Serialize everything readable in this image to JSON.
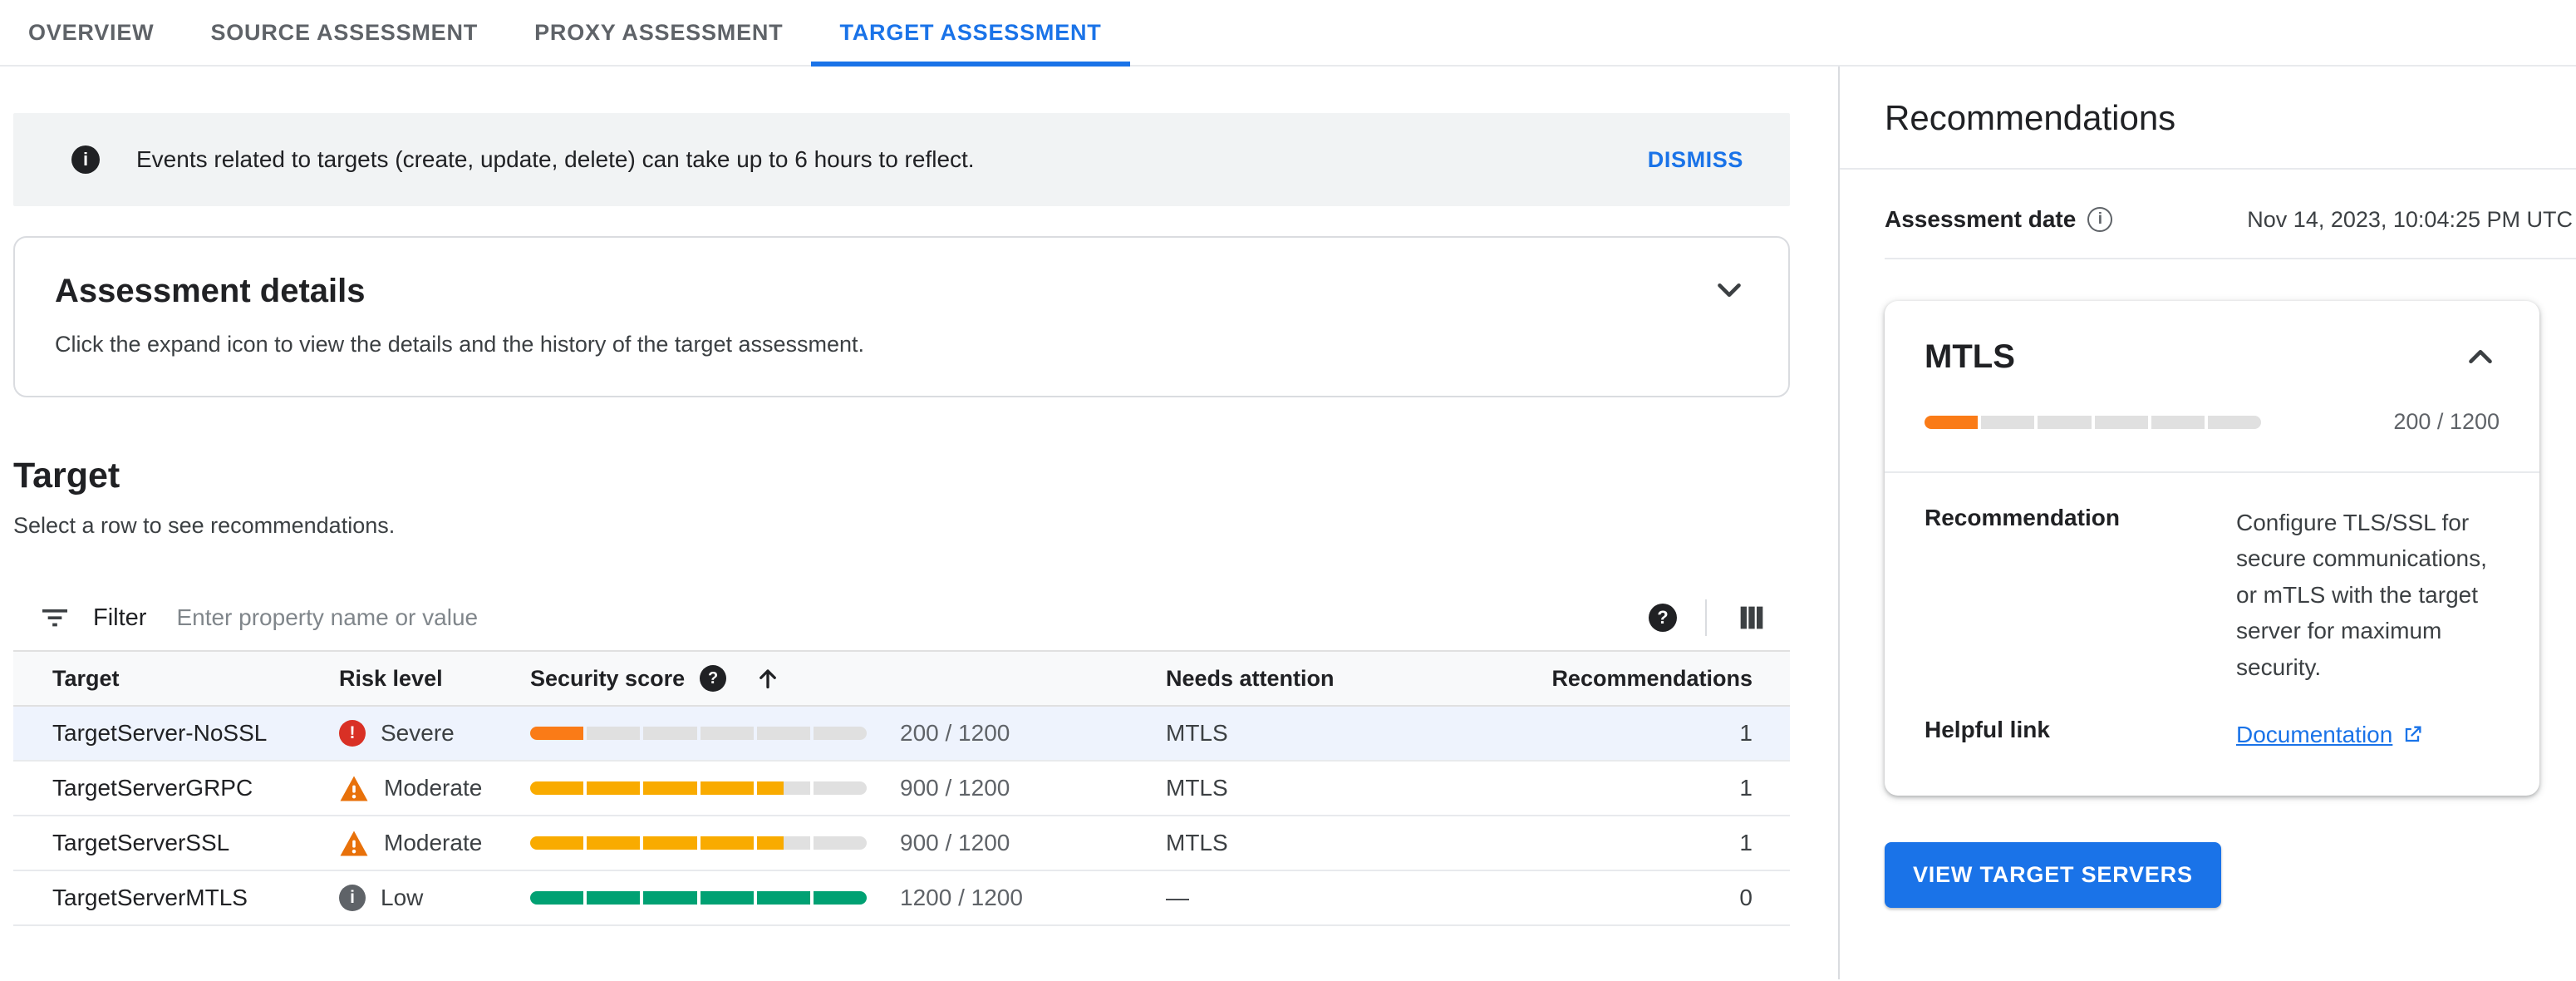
{
  "tabs": [
    {
      "label": "OVERVIEW",
      "active": false
    },
    {
      "label": "SOURCE ASSESSMENT",
      "active": false
    },
    {
      "label": "PROXY ASSESSMENT",
      "active": false
    },
    {
      "label": "TARGET ASSESSMENT",
      "active": true
    }
  ],
  "banner": {
    "text": "Events related to targets (create, update, delete) can take up to 6 hours to reflect.",
    "dismiss_label": "DISMISS"
  },
  "assessment_details": {
    "title": "Assessment details",
    "subtitle": "Click the expand icon to view the details and the history of the target assessment."
  },
  "target_section": {
    "title": "Target",
    "subtitle": "Select a row to see recommendations."
  },
  "filter": {
    "label": "Filter",
    "placeholder": "Enter property name or value"
  },
  "table": {
    "columns": [
      "Target",
      "Risk level",
      "Security score",
      "Needs attention",
      "Recommendations"
    ],
    "rows": [
      {
        "target": "TargetServer-NoSSL",
        "risk": "severe",
        "risk_label": "Severe",
        "score": 200,
        "max": 1200,
        "score_text": "200 / 1200",
        "needs_attention": "MTLS",
        "recommendations": "1",
        "selected": true
      },
      {
        "target": "TargetServerGRPC",
        "risk": "moderate",
        "risk_label": "Moderate",
        "score": 900,
        "max": 1200,
        "score_text": "900 / 1200",
        "needs_attention": "MTLS",
        "recommendations": "1",
        "selected": false
      },
      {
        "target": "TargetServerSSL",
        "risk": "moderate",
        "risk_label": "Moderate",
        "score": 900,
        "max": 1200,
        "score_text": "900 / 1200",
        "needs_attention": "MTLS",
        "recommendations": "1",
        "selected": false
      },
      {
        "target": "TargetServerMTLS",
        "risk": "low",
        "risk_label": "Low",
        "score": 1200,
        "max": 1200,
        "score_text": "1200 / 1200",
        "needs_attention": "—",
        "recommendations": "0",
        "selected": false
      }
    ]
  },
  "panel": {
    "title": "Recommendations",
    "assessment_date_label": "Assessment date",
    "assessment_date_value": "Nov 14, 2023, 10:04:25 PM UTC",
    "card": {
      "title": "MTLS",
      "score": 200,
      "max": 1200,
      "score_text": "200 / 1200",
      "recommendation_label": "Recommendation",
      "recommendation_text": "Configure TLS/SSL for secure communications, or mTLS with the target server for maximum security.",
      "helpful_link_label": "Helpful link",
      "link_text": "Documentation"
    },
    "button_label": "VIEW TARGET SERVERS"
  },
  "icons": {
    "banner_info_glyph": "i",
    "help_glyph": "?",
    "date_info_glyph": "i",
    "severe_glyph": "!",
    "low_glyph": "i"
  },
  "colors": {
    "accent": "#1a73e8",
    "severe": "#d93025",
    "severe_bar": "#fa7b17",
    "moderate": "#e8710a",
    "moderate_bar": "#f9ab00",
    "low_icon": "#5f6368",
    "low_bar": "#00a173",
    "bar_empty": "#e0e0e0"
  }
}
